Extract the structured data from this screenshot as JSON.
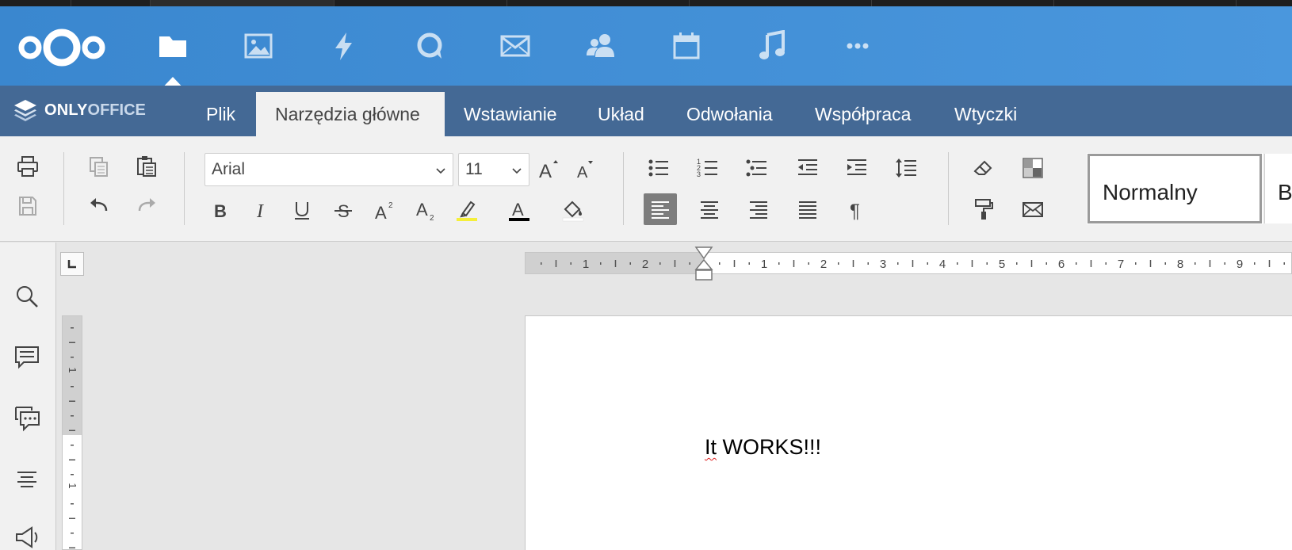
{
  "nextcloud": {
    "apps": [
      {
        "id": "files",
        "icon": "folder-icon",
        "active": true
      },
      {
        "id": "photos",
        "icon": "image-icon",
        "active": false
      },
      {
        "id": "activity",
        "icon": "lightning-icon",
        "active": false
      },
      {
        "id": "talk",
        "icon": "talk-icon",
        "active": false
      },
      {
        "id": "mail",
        "icon": "mail-icon",
        "active": false
      },
      {
        "id": "contacts",
        "icon": "contacts-icon",
        "active": false
      },
      {
        "id": "calendar",
        "icon": "calendar-icon",
        "active": false
      },
      {
        "id": "music",
        "icon": "music-icon",
        "active": false
      },
      {
        "id": "more",
        "icon": "more-icon",
        "active": false
      }
    ]
  },
  "onlyoffice": {
    "logo_bold": "ONLY",
    "logo_light": "OFFICE",
    "tabs": [
      {
        "label": "Plik",
        "active": false
      },
      {
        "label": "Narzędzia główne",
        "active": true
      },
      {
        "label": "Wstawianie",
        "active": false
      },
      {
        "label": "Układ",
        "active": false
      },
      {
        "label": "Odwołania",
        "active": false
      },
      {
        "label": "Współpraca",
        "active": false
      },
      {
        "label": "Wtyczki",
        "active": false
      }
    ]
  },
  "toolbar": {
    "font_name": "Arial",
    "font_size": "11",
    "styles": [
      "Normalny",
      "B"
    ]
  },
  "document": {
    "text_word1": "It",
    "text_rest": " WORKS!!!"
  },
  "ruler": {
    "h_labels_left": [
      "2",
      "1"
    ],
    "h_labels_right": [
      "1",
      "2",
      "3",
      "4",
      "5",
      "6",
      "7",
      "8",
      "9"
    ],
    "v_labels": [
      "1",
      "1"
    ]
  },
  "colors": {
    "nc_blue": "#3a87cf",
    "oo_tabbar": "#446995",
    "toolbar_bg": "#f1f1f1",
    "highlight_yellow": "#f5ef3a"
  }
}
